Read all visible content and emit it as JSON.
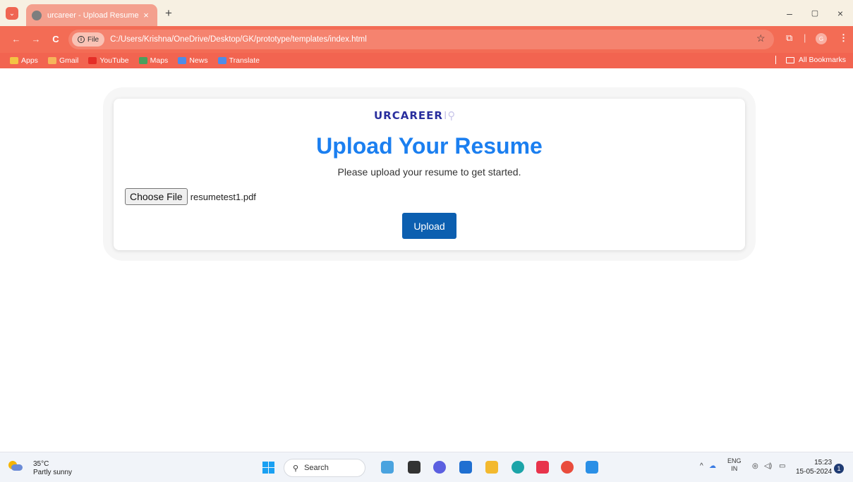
{
  "browser": {
    "tab_title": "urcareer - Upload Resume",
    "tab_close": "×",
    "new_tab": "+",
    "window_controls": {
      "minimize": "–",
      "restore": "▢",
      "close": "×"
    },
    "nav": {
      "back": "←",
      "forward": "→",
      "reload": "C"
    },
    "address": {
      "chip_label": "File",
      "url": "C:/Users/Krishna/OneDrive/Desktop/GK/prototype/templates/index.html"
    },
    "star": "☆",
    "profile_initial": "G",
    "menu": "⋮",
    "bookmarks": [
      {
        "label": "Apps",
        "icon": "apps-grid-icon",
        "color": "#f3c443"
      },
      {
        "label": "Gmail",
        "icon": "gmail-icon",
        "color": "#f6b55a"
      },
      {
        "label": "YouTube",
        "icon": "youtube-icon",
        "color": "#e52d27"
      },
      {
        "label": "Maps",
        "icon": "maps-icon",
        "color": "#4a9f5d"
      },
      {
        "label": "News",
        "icon": "news-icon",
        "color": "#4f8be8"
      },
      {
        "label": "Translate",
        "icon": "translate-icon",
        "color": "#4f8be8"
      }
    ],
    "all_bookmarks": "All Bookmarks"
  },
  "page": {
    "logo_text": "URCAREER",
    "logo_mark": "I⚲",
    "headline": "Upload Your Resume",
    "subtitle": "Please upload your resume to get started.",
    "file_input": {
      "button_label": "Choose File",
      "file_name": "resumetest1.pdf"
    },
    "upload_label": "Upload",
    "accent_color": "#1b7ff0",
    "button_color": "#0c5fb0"
  },
  "taskbar": {
    "weather": {
      "temp": "35°C",
      "condition": "Partly sunny"
    },
    "search_label": "Search",
    "tray": {
      "chevron": "^",
      "lang_top": "ENG",
      "lang_bottom": "IN",
      "wifi": "◎",
      "volume": "◁)",
      "battery": "▭"
    },
    "clock": {
      "time": "15:23",
      "date": "15-05-2024"
    },
    "notification_count": "1"
  }
}
